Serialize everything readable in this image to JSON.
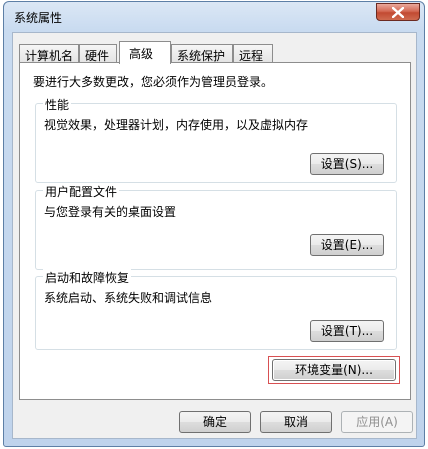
{
  "window": {
    "title": "系统属性",
    "close_icon": "close-x-icon"
  },
  "tabs": [
    {
      "label": "计算机名",
      "active": false
    },
    {
      "label": "硬件",
      "active": false
    },
    {
      "label": "高级",
      "active": true
    },
    {
      "label": "系统保护",
      "active": false
    },
    {
      "label": "远程",
      "active": false
    }
  ],
  "advanced": {
    "admin_note": "要进行大多数更改，您必须作为管理员登录。",
    "performance": {
      "title": "性能",
      "description": "视觉效果，处理器计划，内存使用，以及虚拟内存",
      "button": "设置(S)..."
    },
    "user_profiles": {
      "title": "用户配置文件",
      "description": "与您登录有关的桌面设置",
      "button": "设置(E)..."
    },
    "startup_recovery": {
      "title": "启动和故障恢复",
      "description": "系统启动、系统失败和调试信息",
      "button": "设置(T)..."
    },
    "env_button": "环境变量(N)..."
  },
  "footer": {
    "ok": "确定",
    "cancel": "取消",
    "apply": "应用(A)"
  },
  "colors": {
    "highlight_border": "#d85052",
    "close_button": "#c24a32"
  }
}
